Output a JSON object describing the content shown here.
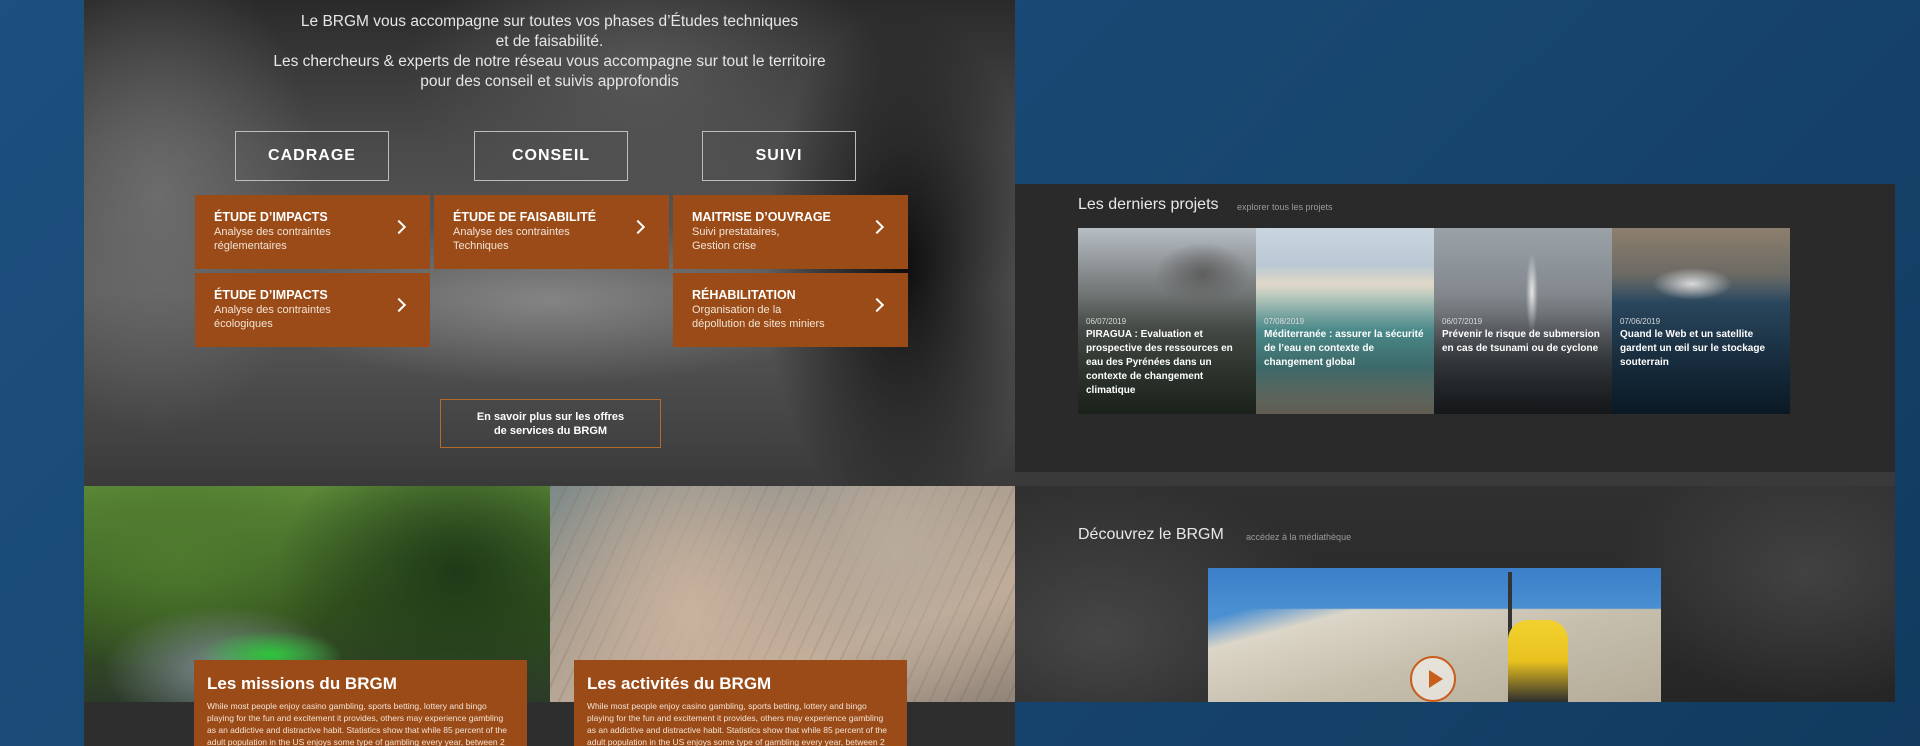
{
  "hero": {
    "line1": "Le BRGM vous accompagne sur toutes vos phases d’Études techniques",
    "line2": "et de faisabilité.",
    "line3": "Les chercheurs & experts de notre réseau vous accompagne sur tout le territoire",
    "line4": "pour des conseil et suivis approfondis"
  },
  "phases": [
    "CADRAGE",
    "CONSEIL",
    "SUIVI"
  ],
  "cards": [
    {
      "title": "ÉTUDE D’IMPACTS",
      "desc1": "Analyse des contraintes",
      "desc2": "réglementaires"
    },
    {
      "title": "ÉTUDE DE FAISABILITÉ",
      "desc1": "Analyse des contraintes",
      "desc2": "Techniques"
    },
    {
      "title": "MAITRISE D’OUVRAGE",
      "desc1": "Suivi prestataires,",
      "desc2": "Gestion crise"
    },
    {
      "title": "ÉTUDE D’IMPACTS",
      "desc1": "Analyse des contraintes",
      "desc2": "écologiques"
    },
    {
      "title": "RÉHABILITATION",
      "desc1": "Organisation de la",
      "desc2": "dépollution de sites miniers"
    }
  ],
  "more_button": {
    "line1": "En savoir plus sur les offres",
    "line2": "de services du BRGM"
  },
  "missions": {
    "title": "Les missions du BRGM",
    "text": "While most people enjoy casino gambling, sports betting, lottery and bingo playing for the fun and excitement it provides, others may experience gambling as an addictive and distractive habit. Statistics show that while 85 percent of the adult population in the US enjoys some type of gambling every year, between 2"
  },
  "activites": {
    "title": "Les activités du BRGM",
    "text": "While most people enjoy casino gambling, sports betting, lottery and bingo playing for the fun and excitement it provides, others may experience gambling as an addictive and distractive habit. Statistics show that while 85 percent of the adult population in the US enjoys some type of gambling every year, between 2"
  },
  "projects": {
    "title": "Les derniers projets",
    "link": "explorer tous les projets",
    "items": [
      {
        "date": "06/07/2019",
        "title": "PIRAGUA : Evaluation et prospective des ressources en eau des Pyrénées dans un contexte de changement climatique"
      },
      {
        "date": "07/08/2019",
        "title": "Méditerranée : assurer la sécurité de l’eau en contexte de changement global"
      },
      {
        "date": "06/07/2019",
        "title": "Prévenir le risque de submersion en cas de tsunami ou de cyclone"
      },
      {
        "date": "07/06/2019",
        "title": "Quand le Web et un satellite gardent un œil sur le stockage souterrain"
      }
    ]
  },
  "discover": {
    "title": "Découvrez le BRGM",
    "link": "accédez à la médiathèque"
  }
}
